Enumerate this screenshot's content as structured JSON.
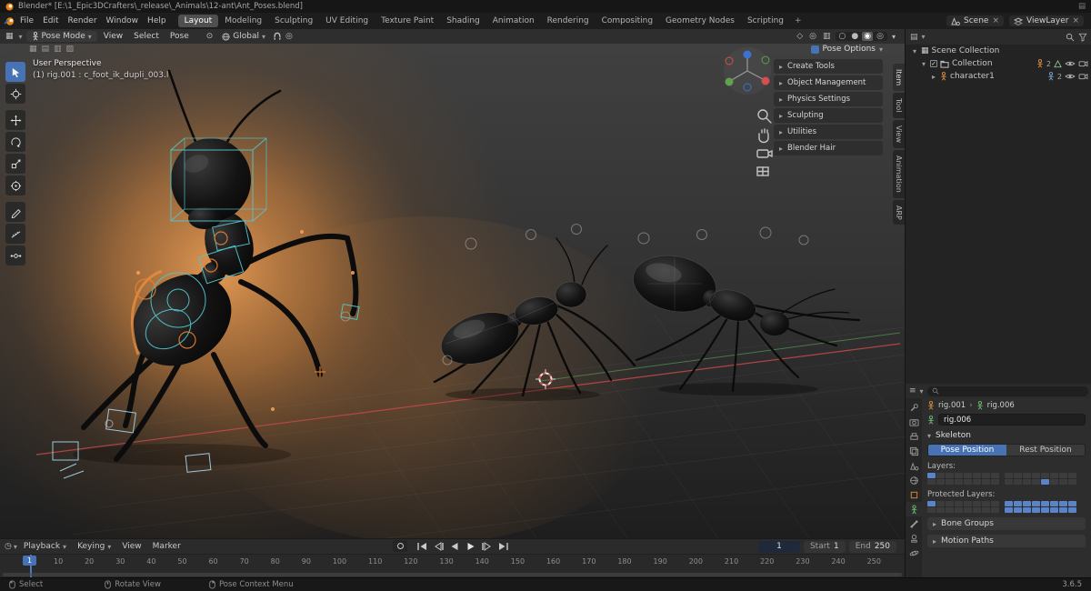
{
  "window": {
    "title": "Blender* [E:\\1_Epic3DCrafters\\_release\\_Animals\\12-ant\\Ant_Poses.blend]"
  },
  "icons": {
    "caret_down": "▾",
    "caret_right": "▸",
    "close": "×",
    "plus": "+",
    "pivot": "⊙",
    "proportional": "◎",
    "grid": "▦",
    "grid2": "▤",
    "grid3": "▥",
    "grid4": "▨",
    "clock": "◷",
    "lines": "≡",
    "check": "✓",
    "chev": "›",
    "circle_open": "○",
    "circle_solid": "●",
    "circle_fish": "◉",
    "circle_double": "◎",
    "diamond": "◇"
  },
  "topbar": {
    "menus": [
      "File",
      "Edit",
      "Render",
      "Window",
      "Help"
    ],
    "workspaces": [
      "Layout",
      "Modeling",
      "Sculpting",
      "UV Editing",
      "Texture Paint",
      "Shading",
      "Animation",
      "Rendering",
      "Compositing",
      "Geometry Nodes",
      "Scripting"
    ],
    "active_workspace": "Layout",
    "scene": "Scene",
    "viewlayer": "ViewLayer"
  },
  "viewport_header": {
    "mode": "Pose Mode",
    "menus": [
      "View",
      "Select",
      "Pose"
    ],
    "orientation": "Global"
  },
  "overlay_panel": {
    "title": "Pose Options",
    "sections": [
      "Create Tools",
      "Object Management",
      "Physics Settings",
      "Sculpting",
      "Utilities",
      "Blender Hair"
    ]
  },
  "viewport": {
    "view_label": "User Perspective",
    "selection_label": "(1) rig.001 : c_foot_ik_dupli_003.l"
  },
  "side_tabs": [
    "Item",
    "Tool",
    "View",
    "Animation",
    "ARP"
  ],
  "outliner": {
    "root": "Scene Collection",
    "collection": "Collection",
    "collection_count": "2",
    "character": "character1",
    "character_count": "2"
  },
  "properties": {
    "breadcrumb_object": "rig.001",
    "breadcrumb_data": "rig.006",
    "name_value": "rig.006",
    "skeleton": "Skeleton",
    "pose_position": "Pose Position",
    "rest_position": "Rest Position",
    "layers": "Layers:",
    "protected_layers": "Protected Layers:",
    "bone_groups": "Bone Groups",
    "motion_paths": "Motion Paths"
  },
  "armature_layers": {
    "layers_a": {
      "cells": 16,
      "active": [
        0
      ]
    },
    "layers_b": {
      "cells": 16,
      "active": [
        12
      ]
    },
    "protected_a": {
      "cells": 16,
      "active": [
        0
      ]
    },
    "protected_b": {
      "cells": 16,
      "active": [
        0,
        1,
        2,
        3,
        4,
        5,
        6,
        7,
        8,
        9,
        10,
        11,
        12,
        13,
        14,
        15
      ]
    }
  },
  "timeline": {
    "menus": [
      "Playback",
      "Keying",
      "View",
      "Marker"
    ],
    "current_frame": "1",
    "playhead_frame": "1",
    "start_label": "Start",
    "start_value": "1",
    "end_label": "End",
    "end_value": "250",
    "ticks": [
      "1",
      "10",
      "20",
      "30",
      "40",
      "50",
      "60",
      "70",
      "80",
      "90",
      "100",
      "110",
      "120",
      "130",
      "140",
      "150",
      "160",
      "170",
      "180",
      "190",
      "200",
      "210",
      "220",
      "230",
      "240",
      "250"
    ]
  },
  "statusbar": {
    "select": "Select",
    "rotate_view": "Rotate View",
    "pose_context_menu": "Pose Context Menu",
    "version": "3.6.5"
  },
  "colors": {
    "accent": "#4772b3",
    "glow": "#e8853a"
  }
}
